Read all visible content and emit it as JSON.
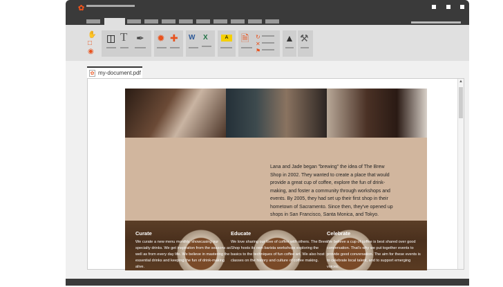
{
  "document_tab": {
    "filename": "my-document.pdf"
  },
  "page": {
    "intro": "Lana and Jade began \"brewing\" the idea of The Brew Shop in 2002. They wanted to create a place that would provide a great cup of coffee, explore the fun of drink-making, and foster a community through workshops and events. By 2005, they had set up their first shop in their hometown of Sacramento. Since then, they've opened up shops in San Francisco, Santa Monica, and Tokyo.",
    "columns": [
      {
        "title": "Curate",
        "text": "We curate a new menu monthly, showcasing our specialty drinks. We get inspiration from the seasons as well as from every day life. We believe in mastering the essential drinks and keeping the fun of drink-making alive."
      },
      {
        "title": "Educate",
        "text": "We love sharing our love of coffee with others. The Brew Shop hosts its own barista workshops exploring the basics to the techniques of fun coffee art. We also host classes on the history and culture of coffee making."
      },
      {
        "title": "Celebrate",
        "text": "We believe a cup of coffee is best shared over good conversation. That's why we put together events to provide good conversation. The aim for these events is to celebrate local talent, and to support emerging voices."
      }
    ]
  },
  "colors": {
    "accent": "#e8521d",
    "chrome": "#3a3a3a",
    "toolbar": "#e0e0e0"
  }
}
